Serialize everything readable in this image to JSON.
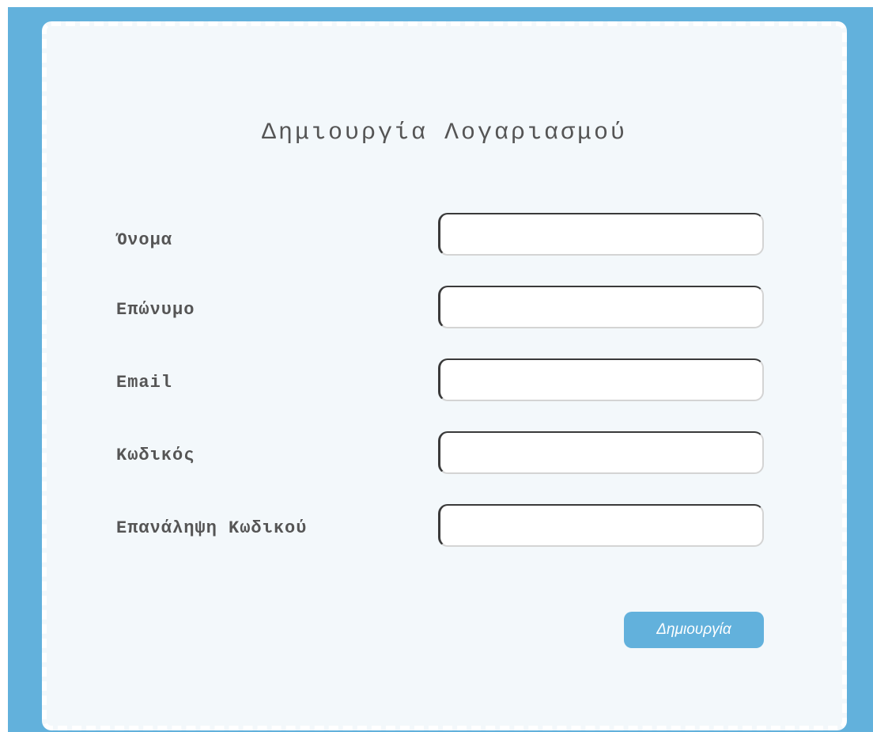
{
  "form": {
    "title": "Δημιουργία Λογαριασμού",
    "fields": [
      {
        "label": "Όνομα",
        "value": "",
        "placeholder": ""
      },
      {
        "label": "Επώνυμο",
        "value": "",
        "placeholder": ""
      },
      {
        "label": "Email",
        "value": "",
        "placeholder": ""
      },
      {
        "label": "Κωδικός",
        "value": "",
        "placeholder": ""
      },
      {
        "label": "Επανάληψη Κωδικού",
        "value": "",
        "placeholder": ""
      }
    ],
    "submit_label": "Δημιουργία"
  },
  "colors": {
    "frame_background": "#62b1dc",
    "card_background": "#f3f8fb",
    "border_dash": "#ffffff",
    "text": "#555555",
    "button": "#62b1dc",
    "button_text": "#ffffff"
  }
}
